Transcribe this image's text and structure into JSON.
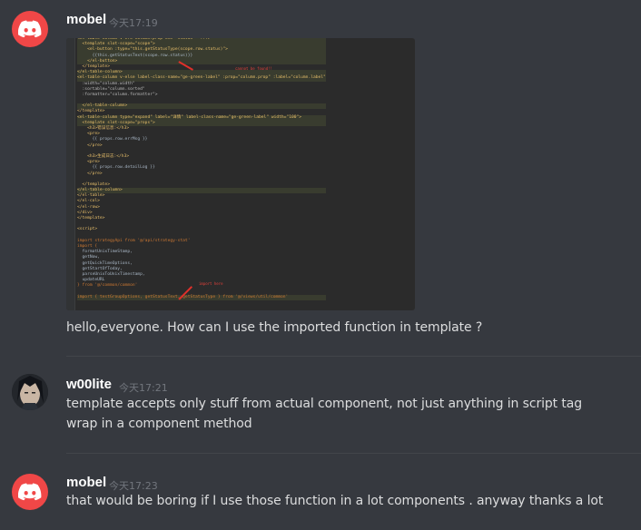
{
  "messages": [
    {
      "username": "mobel",
      "timestamp": "今天17:19",
      "avatar": "discord-logo-icon",
      "text": "hello,everyone. How can I use the imported function in template ?",
      "image": {
        "code_lines": [
          "<el-table-column v-if=\"column.prop === 'status'\" ...>",
          "  <template slot-scope=\"scope\">",
          "    <el-button :type=\"this.getStatusType(scope.row.status)\">",
          "      {{this.getStatusText(scope.row.status)}}",
          "    </el-button>",
          "  </template>",
          "</el-table-column>",
          "<el-table-column v-else label-class-name=\"ge-green-label\" :prop=\"column.prop\" :label=\"column.label\"",
          "  :width=\"column.width\"",
          "  :sortable=\"column.sorted\"",
          "  :formatter=\"column.formatter\">",
          "",
          "  </el-table-column>",
          "</template>",
          "<el-table-column type=\"expand\" label=\"详情\" label-class-name=\"ge-green-label\" width=\"100\">",
          "  <template slot-scope=\"props\">",
          "    <h3>错误信息:</h3>",
          "    <pre>",
          "      {{ props.row.errMsg }}",
          "    </pre>",
          "",
          "    <h3>生成日志:</h3>",
          "    <pre>",
          "      {{ props.row.detailLog }}",
          "    </pre>",
          "",
          "  </template>",
          "</el-table-column>",
          "</el-table>",
          "</el-col>",
          "</el-row>",
          "</div>",
          "</template>",
          "",
          "<script>",
          "",
          "import strategyApi from '@/api/strategy-stat'",
          "import {",
          "  formatUnixTimeStamp,",
          "  getNow,",
          "  getQuickTimeOptions,",
          "  getStartOfToday,",
          "  parseUnixToUnixTimestamp,",
          "  updateURL",
          "} from '@/common/common'",
          "",
          "import { testGroupOptions, getStatusText, getStatusType } from '@/views/util/common'"
        ],
        "annotations": [
          "cannot be found!!",
          "import here"
        ]
      }
    },
    {
      "username": "w00lite",
      "timestamp": "今天17:21",
      "avatar": "user-photo-avatar",
      "lines": [
        "template accepts only stuff from actual component, not just anything in script tag",
        "wrap in a component method"
      ]
    },
    {
      "username": "mobel",
      "timestamp": "今天17:23",
      "avatar": "discord-logo-icon",
      "text": "that would be  boring if I use those function in a lot components . anyway thanks a lot"
    }
  ],
  "colors": {
    "background": "#36393f",
    "avatar_red": "#f04747",
    "username": "#ffffff",
    "timestamp": "#72767d",
    "text": "#dcddde"
  }
}
